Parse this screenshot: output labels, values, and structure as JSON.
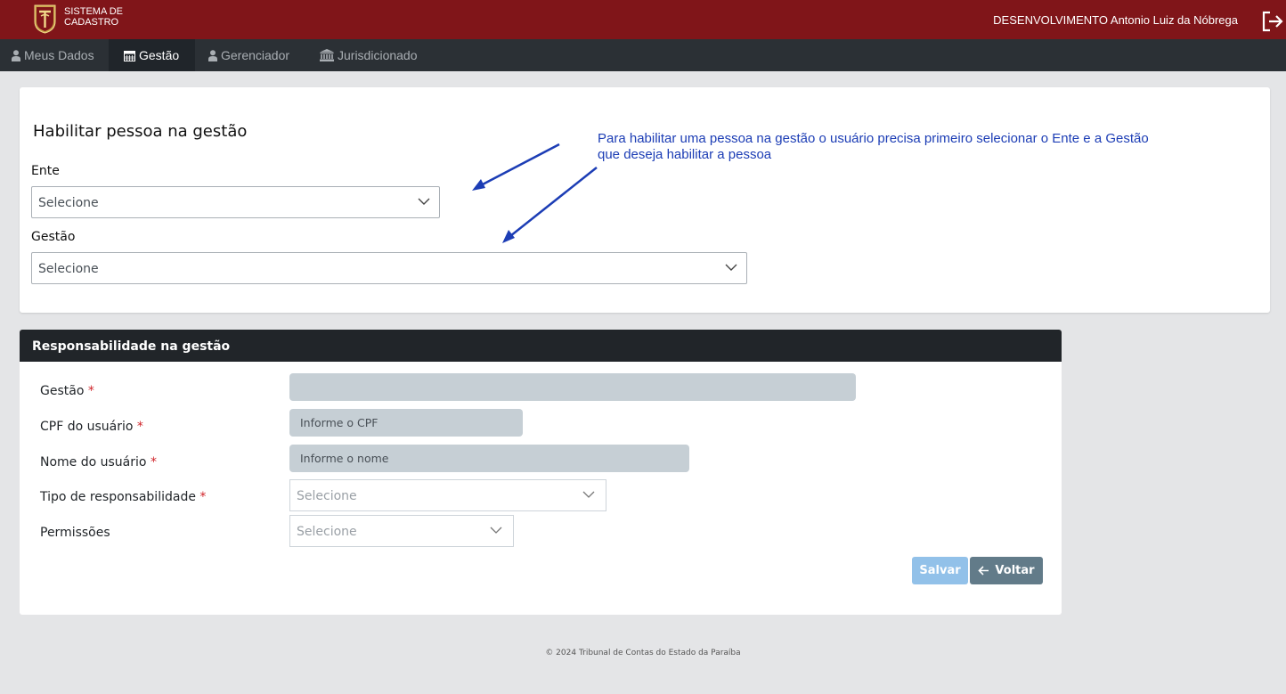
{
  "header": {
    "system_line1": "SISTEMA DE",
    "system_line2": "CADASTRO",
    "environment_user": "DESENVOLVIMENTO Antonio Luiz da Nóbrega",
    "brand_color": "#801519"
  },
  "nav": {
    "items": [
      {
        "label": "Meus Dados",
        "icon": "user-icon"
      },
      {
        "label": "Gestão",
        "icon": "calendar-icon",
        "active": true
      },
      {
        "label": "Gerenciador",
        "icon": "user-icon"
      },
      {
        "label": "Jurisdicionado",
        "icon": "institution-icon"
      }
    ]
  },
  "habilitar": {
    "title": "Habilitar pessoa na gestão",
    "ente_label": "Ente",
    "ente_value": "Selecione",
    "gestao_label": "Gestão",
    "gestao_value": "Selecione"
  },
  "annotation": {
    "line1": "Para habilitar uma pessoa na gestão o usuário precisa primeiro selecionar o Ente e a Gestão",
    "line2": "que deseja habilitar a pessoa",
    "color": "#1c3db5"
  },
  "responsabilidade": {
    "header": "Responsabilidade na gestão",
    "gestao_label": "Gestão",
    "cpf_label": "CPF do usuário",
    "cpf_placeholder": "Informe o CPF",
    "nome_label": "Nome do usuário",
    "nome_placeholder": "Informe o nome",
    "tipo_label": "Tipo de responsabilidade",
    "tipo_value": "Selecione",
    "permissoes_label": "Permissões",
    "permissoes_value": "Selecione",
    "required_mark": "*",
    "save_label": "Salvar",
    "back_label": "Voltar"
  },
  "footer": {
    "text": "© 2024 Tribunal de Contas do Estado da Paraíba"
  }
}
